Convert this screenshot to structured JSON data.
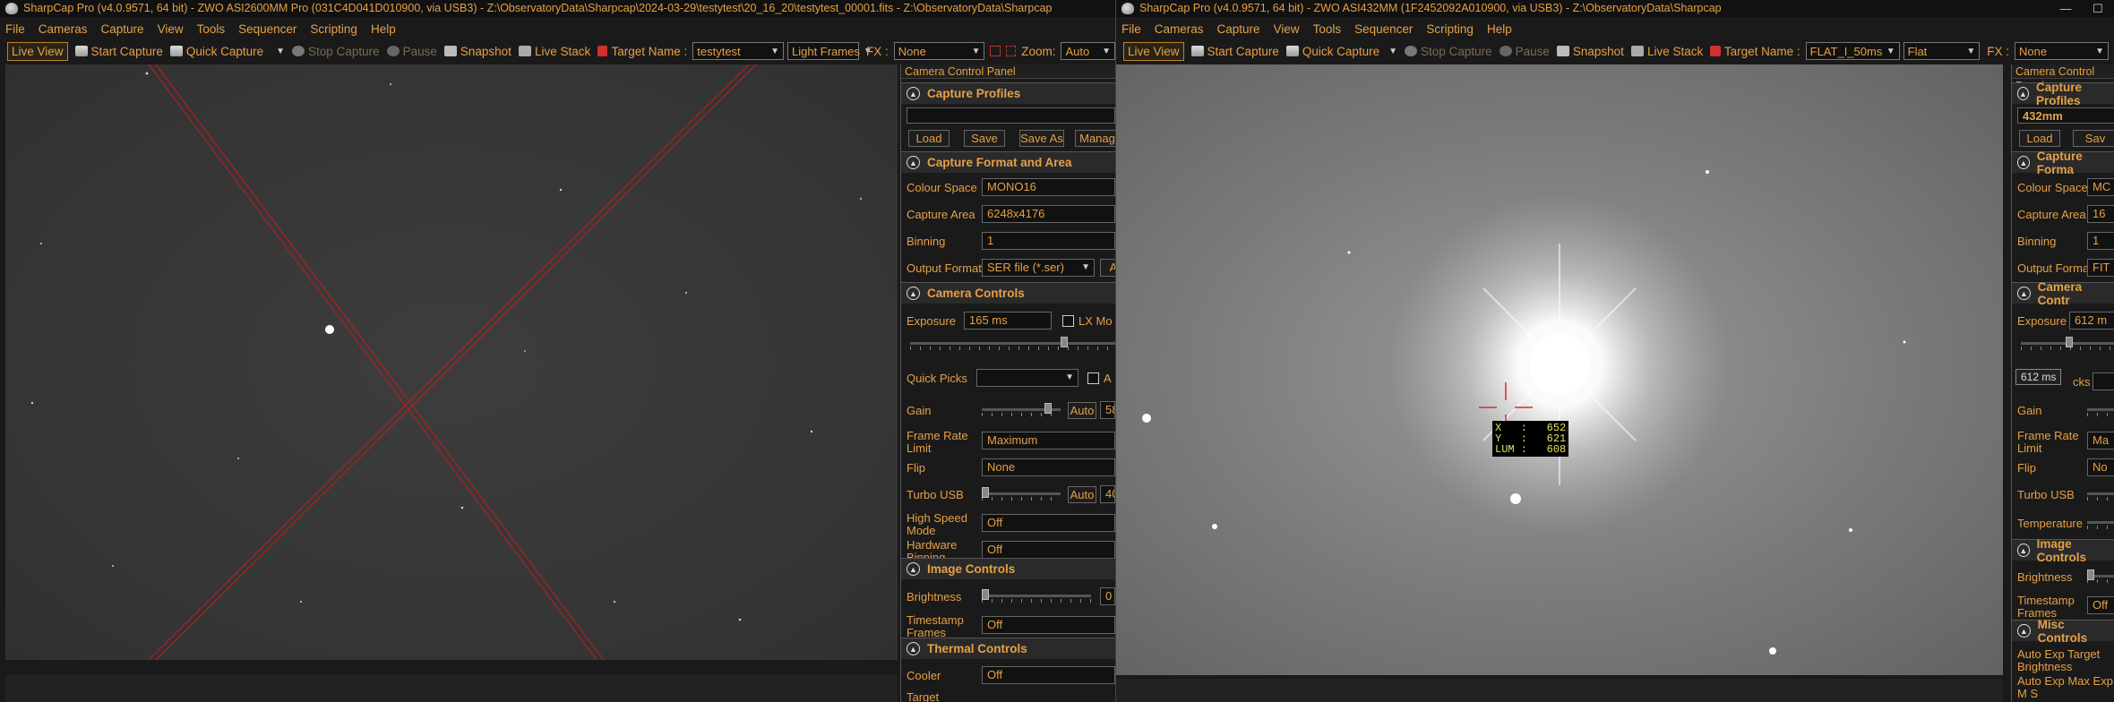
{
  "window1": {
    "title": "SharpCap Pro (v4.0.9571, 64 bit) - ZWO ASI2600MM Pro (031C4D041D010900, via USB3) - Z:\\ObservatoryData\\Sharpcap\\2024-03-29\\testytest\\20_16_20\\testytest_00001.fits - Z:\\ObservatoryData\\Sharpcap",
    "menu": [
      "File",
      "Cameras",
      "Capture",
      "View",
      "Tools",
      "Sequencer",
      "Scripting",
      "Help"
    ],
    "toolbar": {
      "live_view": "Live View",
      "start_capture": "Start Capture",
      "quick_capture": "Quick Capture",
      "stop_capture": "Stop Capture",
      "pause": "Pause",
      "snapshot": "Snapshot",
      "live_stack": "Live Stack",
      "target_name_label": "Target Name :",
      "target_name": "testytest",
      "frame_type": "Light Frames",
      "fx_label": "FX :",
      "fx_value": "None",
      "zoom_label": "Zoom:",
      "zoom_value": "Auto"
    },
    "panel": {
      "title": "Camera Control Panel",
      "capture_profiles": {
        "header": "Capture Profiles",
        "profile_value": "",
        "load": "Load",
        "save": "Save",
        "save_as": "Save As",
        "manage": "Manag"
      },
      "format": {
        "header": "Capture Format and Area",
        "colour_space_label": "Colour Space",
        "colour_space": "MONO16",
        "capture_area_label": "Capture Area",
        "capture_area": "6248x4176",
        "binning_label": "Binning",
        "binning": "1",
        "output_format_label": "Output Format",
        "output_format": "SER file (*.ser)",
        "extra_btn": "A"
      },
      "camera_controls": {
        "header": "Camera Controls",
        "exposure_label": "Exposure",
        "exposure": "165 ms",
        "lx_mode": "LX Mo",
        "quick_picks_label": "Quick Picks",
        "quick_picks": "",
        "quick_picks_auto": "A",
        "gain_label": "Gain",
        "gain_auto": "Auto",
        "gain_value": "58",
        "frame_rate_label": "Frame Rate Limit",
        "frame_rate": "Maximum",
        "flip_label": "Flip",
        "flip": "None",
        "turbo_usb_label": "Turbo USB",
        "turbo_auto": "Auto",
        "turbo_value": "40",
        "high_speed_label": "High Speed Mode",
        "high_speed": "Off",
        "hw_binning_label": "Hardware Binning",
        "hw_binning": "Off"
      },
      "image_controls": {
        "header": "Image Controls",
        "brightness_label": "Brightness",
        "brightness_value": "0",
        "timestamp_label": "Timestamp Frames",
        "timestamp": "Off"
      },
      "thermal_controls": {
        "header": "Thermal Controls",
        "cooler_label": "Cooler",
        "cooler": "Off",
        "target_label": "Target"
      }
    }
  },
  "window2": {
    "title": "SharpCap Pro (v4.0.9571, 64 bit) - ZWO ASI432MM (1F2452092A010900, via USB3) - Z:\\ObservatoryData\\Sharpcap",
    "menu": [
      "File",
      "Cameras",
      "Capture",
      "View",
      "Tools",
      "Sequencer",
      "Scripting",
      "Help"
    ],
    "toolbar": {
      "live_view": "Live View",
      "start_capture": "Start Capture",
      "quick_capture": "Quick Capture",
      "stop_capture": "Stop Capture",
      "pause": "Pause",
      "snapshot": "Snapshot",
      "live_stack": "Live Stack",
      "target_name_label": "Target Name :",
      "target_name": "FLAT_I_50ms",
      "frame_type": "Flat",
      "fx_label": "FX :",
      "fx_value": "None"
    },
    "readout": {
      "x_label": "X",
      "x_value": "652",
      "y_label": "Y",
      "y_value": "621",
      "lum_label": "LUM",
      "lum_value": "608"
    },
    "panel": {
      "title": "Camera Control Panel",
      "capture_profiles_header": "Capture Profiles",
      "profile_value": "432mm",
      "load": "Load",
      "save": "Sav",
      "format_header": "Capture Forma",
      "colour_space_label": "Colour Space",
      "colour_space": "MC",
      "capture_area_label": "Capture Area",
      "capture_area": "16",
      "binning_label": "Binning",
      "binning": "1",
      "output_format_label": "Output Format",
      "output_format": "FIT",
      "camera_controls_header": "Camera Contr",
      "exposure_label": "Exposure",
      "exposure": "612 m",
      "exposure_tooltip": "612 ms",
      "quick_picks_partial": "cks",
      "gain_label": "Gain",
      "frame_rate_label": "Frame Rate Limit",
      "frame_rate": "Ma",
      "flip_label": "Flip",
      "flip": "No",
      "turbo_usb_label": "Turbo USB",
      "temperature_label": "Temperature",
      "image_controls_header": "Image Controls",
      "brightness_label": "Brightness",
      "timestamp_label": "Timestamp Frames",
      "timestamp": "Off",
      "misc_controls_header": "Misc Controls",
      "auto_exp_target_label": "Auto Exp Target Brightness",
      "auto_exp_max_label": "Auto Exp Max Exp M S"
    }
  }
}
